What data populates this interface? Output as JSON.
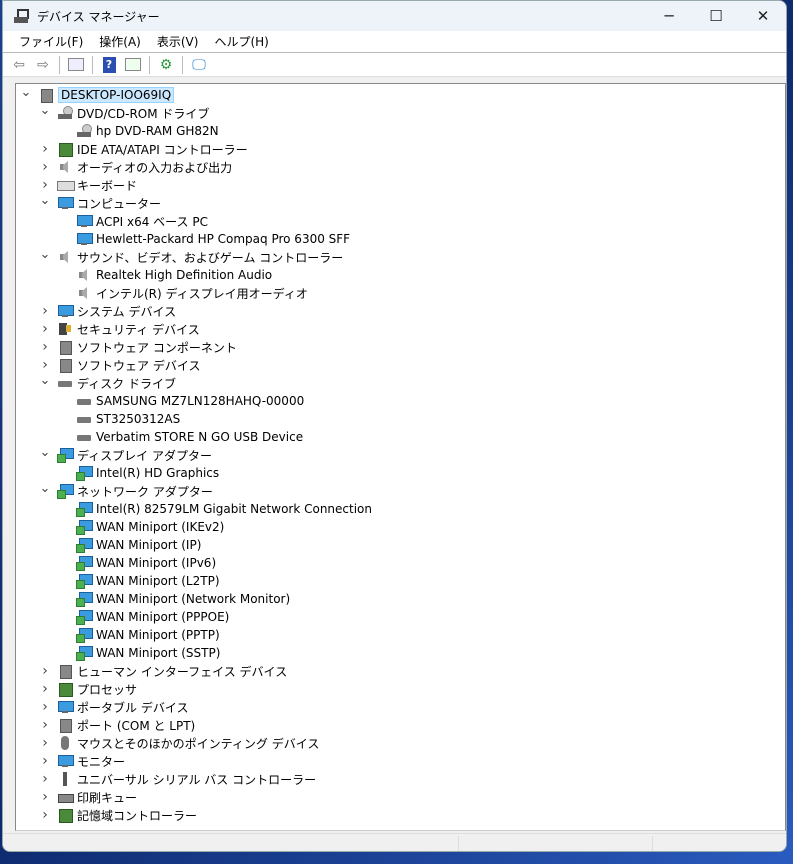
{
  "window": {
    "title": "デバイス マネージャー",
    "minimize": "─",
    "maximize": "☐",
    "close": "✕"
  },
  "menu": [
    "ファイル(F)",
    "操作(A)",
    "表示(V)",
    "ヘルプ(H)"
  ],
  "toolbar": [
    "back",
    "forward",
    "properties",
    "help",
    "update-driver",
    "scan-hardware",
    "monitor"
  ],
  "tree": [
    {
      "level": 0,
      "state": "open",
      "icon": "app",
      "label": "DESKTOP-IOO69IQ",
      "selected": true
    },
    {
      "level": 1,
      "state": "open",
      "icon": "dvd",
      "label": "DVD/CD-ROM ドライブ"
    },
    {
      "level": 2,
      "icon": "dvd",
      "label": "hp DVD-RAM GH82N"
    },
    {
      "level": 1,
      "state": "closed",
      "icon": "chip",
      "label": "IDE ATA/ATAPI コントローラー"
    },
    {
      "level": 1,
      "state": "closed",
      "icon": "speaker",
      "label": "オーディオの入力および出力"
    },
    {
      "level": 1,
      "state": "closed",
      "icon": "kbd",
      "label": "キーボード"
    },
    {
      "level": 1,
      "state": "open",
      "icon": "monitor",
      "label": "コンピューター"
    },
    {
      "level": 2,
      "icon": "monitor",
      "label": "ACPI x64 ベース PC"
    },
    {
      "level": 2,
      "icon": "monitor",
      "label": "Hewlett-Packard HP Compaq Pro 6300 SFF"
    },
    {
      "level": 1,
      "state": "open",
      "icon": "speaker",
      "label": "サウンド、ビデオ、およびゲーム コントローラー"
    },
    {
      "level": 2,
      "icon": "speaker",
      "label": "Realtek High Definition Audio"
    },
    {
      "level": 2,
      "icon": "speaker",
      "label": "インテル(R) ディスプレイ用オーディオ"
    },
    {
      "level": 1,
      "state": "closed",
      "icon": "monitor",
      "label": "システム デバイス"
    },
    {
      "level": 1,
      "state": "closed",
      "icon": "sec",
      "label": "セキュリティ デバイス"
    },
    {
      "level": 1,
      "state": "closed",
      "icon": "gen",
      "label": "ソフトウェア コンポーネント"
    },
    {
      "level": 1,
      "state": "closed",
      "icon": "gen",
      "label": "ソフトウェア デバイス"
    },
    {
      "level": 1,
      "state": "open",
      "icon": "disk",
      "label": "ディスク ドライブ"
    },
    {
      "level": 2,
      "icon": "disk",
      "label": "SAMSUNG MZ7LN128HAHQ-00000"
    },
    {
      "level": 2,
      "icon": "disk",
      "label": "ST3250312AS"
    },
    {
      "level": 2,
      "icon": "disk",
      "label": "Verbatim STORE N GO USB Device"
    },
    {
      "level": 1,
      "state": "open",
      "icon": "net",
      "label": "ディスプレイ アダプター"
    },
    {
      "level": 2,
      "icon": "net",
      "label": "Intel(R) HD Graphics"
    },
    {
      "level": 1,
      "state": "open",
      "icon": "net",
      "label": "ネットワーク アダプター"
    },
    {
      "level": 2,
      "icon": "net",
      "label": "Intel(R) 82579LM Gigabit Network Connection"
    },
    {
      "level": 2,
      "icon": "net",
      "label": "WAN Miniport (IKEv2)"
    },
    {
      "level": 2,
      "icon": "net",
      "label": "WAN Miniport (IP)"
    },
    {
      "level": 2,
      "icon": "net",
      "label": "WAN Miniport (IPv6)"
    },
    {
      "level": 2,
      "icon": "net",
      "label": "WAN Miniport (L2TP)"
    },
    {
      "level": 2,
      "icon": "net",
      "label": "WAN Miniport (Network Monitor)"
    },
    {
      "level": 2,
      "icon": "net",
      "label": "WAN Miniport (PPPOE)"
    },
    {
      "level": 2,
      "icon": "net",
      "label": "WAN Miniport (PPTP)"
    },
    {
      "level": 2,
      "icon": "net",
      "label": "WAN Miniport (SSTP)"
    },
    {
      "level": 1,
      "state": "closed",
      "icon": "gen",
      "label": "ヒューマン インターフェイス デバイス"
    },
    {
      "level": 1,
      "state": "closed",
      "icon": "chip",
      "label": "プロセッサ"
    },
    {
      "level": 1,
      "state": "closed",
      "icon": "monitor",
      "label": "ポータブル デバイス"
    },
    {
      "level": 1,
      "state": "closed",
      "icon": "gen",
      "label": "ポート (COM と LPT)"
    },
    {
      "level": 1,
      "state": "closed",
      "icon": "mouse",
      "label": "マウスとそのほかのポインティング デバイス"
    },
    {
      "level": 1,
      "state": "closed",
      "icon": "monitor",
      "label": "モニター"
    },
    {
      "level": 1,
      "state": "closed",
      "icon": "usb",
      "label": "ユニバーサル シリアル バス コントローラー"
    },
    {
      "level": 1,
      "state": "closed",
      "icon": "print",
      "label": "印刷キュー"
    },
    {
      "level": 1,
      "state": "closed",
      "icon": "chip",
      "label": "記憶域コントローラー"
    }
  ]
}
